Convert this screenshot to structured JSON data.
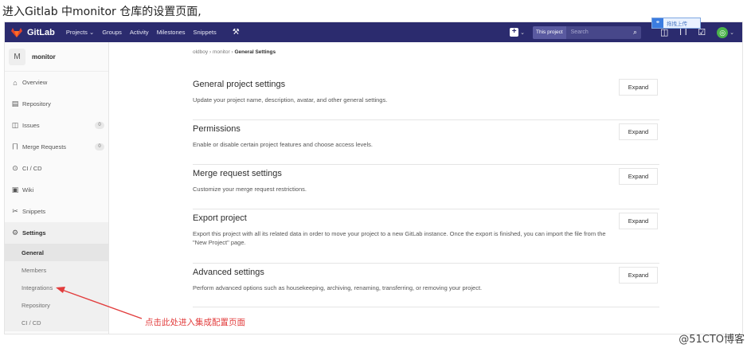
{
  "caption_top": "进入Gitlab 中monitor 仓库的设置页面,",
  "navbar": {
    "brand": "GitLab",
    "links": [
      "Projects ⌄",
      "Groups",
      "Activity",
      "Milestones",
      "Snippets"
    ],
    "search_scope": "This project",
    "search_placeholder": "Search",
    "brand_color": "#2b2b6e"
  },
  "tooltip": {
    "text": "拖拽上传"
  },
  "sidebar": {
    "project_initial": "M",
    "project_name": "monitor",
    "items": [
      {
        "label": "Overview",
        "icon": "home-icon"
      },
      {
        "label": "Repository",
        "icon": "book-icon"
      },
      {
        "label": "Issues",
        "icon": "issues-icon",
        "count": "0"
      },
      {
        "label": "Merge Requests",
        "icon": "merge-icon",
        "count": "0"
      },
      {
        "label": "CI / CD",
        "icon": "pipeline-icon"
      },
      {
        "label": "Wiki",
        "icon": "wiki-icon"
      },
      {
        "label": "Snippets",
        "icon": "scissors-icon"
      }
    ],
    "settings_label": "Settings",
    "settings_sub": [
      "General",
      "Members",
      "Integrations",
      "Repository",
      "CI / CD"
    ]
  },
  "breadcrumb": {
    "group": "oldboy",
    "project": "monitor",
    "current": "General Settings"
  },
  "sections": [
    {
      "title": "General project settings",
      "desc": "Update your project name, description, avatar, and other general settings.",
      "button": "Expand"
    },
    {
      "title": "Permissions",
      "desc": "Enable or disable certain project features and choose access levels.",
      "button": "Expand"
    },
    {
      "title": "Merge request settings",
      "desc": "Customize your merge request restrictions.",
      "button": "Expand"
    },
    {
      "title": "Export project",
      "desc": "Export this project with all its related data in order to move your project to a new GitLab instance. Once the export is finished, you can import the file from the \"New Project\" page.",
      "button": "Expand"
    },
    {
      "title": "Advanced settings",
      "desc": "Perform advanced options such as housekeeping, archiving, renaming, transferring, or removing your project.",
      "button": "Expand"
    }
  ],
  "annotation": "点击此处进入集成配置页面",
  "watermark": "@51CTO博客",
  "annotation_color": "#e23d3d"
}
